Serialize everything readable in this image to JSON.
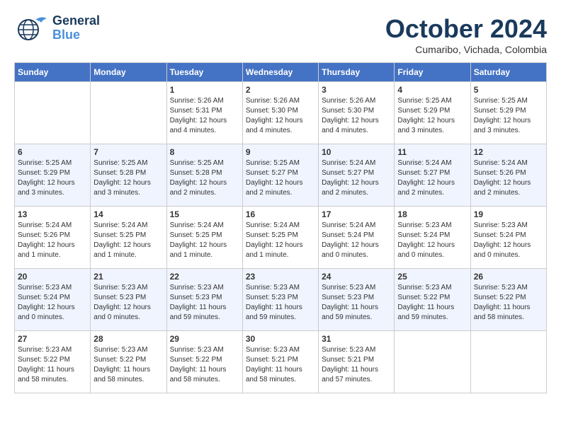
{
  "header": {
    "logo_line1": "General",
    "logo_line2": "Blue",
    "month_title": "October 2024",
    "location": "Cumaribo, Vichada, Colombia"
  },
  "days_of_week": [
    "Sunday",
    "Monday",
    "Tuesday",
    "Wednesday",
    "Thursday",
    "Friday",
    "Saturday"
  ],
  "weeks": [
    [
      {
        "day": "",
        "info": ""
      },
      {
        "day": "",
        "info": ""
      },
      {
        "day": "1",
        "info": "Sunrise: 5:26 AM\nSunset: 5:31 PM\nDaylight: 12 hours\nand 4 minutes."
      },
      {
        "day": "2",
        "info": "Sunrise: 5:26 AM\nSunset: 5:30 PM\nDaylight: 12 hours\nand 4 minutes."
      },
      {
        "day": "3",
        "info": "Sunrise: 5:26 AM\nSunset: 5:30 PM\nDaylight: 12 hours\nand 4 minutes."
      },
      {
        "day": "4",
        "info": "Sunrise: 5:25 AM\nSunset: 5:29 PM\nDaylight: 12 hours\nand 3 minutes."
      },
      {
        "day": "5",
        "info": "Sunrise: 5:25 AM\nSunset: 5:29 PM\nDaylight: 12 hours\nand 3 minutes."
      }
    ],
    [
      {
        "day": "6",
        "info": "Sunrise: 5:25 AM\nSunset: 5:29 PM\nDaylight: 12 hours\nand 3 minutes."
      },
      {
        "day": "7",
        "info": "Sunrise: 5:25 AM\nSunset: 5:28 PM\nDaylight: 12 hours\nand 3 minutes."
      },
      {
        "day": "8",
        "info": "Sunrise: 5:25 AM\nSunset: 5:28 PM\nDaylight: 12 hours\nand 2 minutes."
      },
      {
        "day": "9",
        "info": "Sunrise: 5:25 AM\nSunset: 5:27 PM\nDaylight: 12 hours\nand 2 minutes."
      },
      {
        "day": "10",
        "info": "Sunrise: 5:24 AM\nSunset: 5:27 PM\nDaylight: 12 hours\nand 2 minutes."
      },
      {
        "day": "11",
        "info": "Sunrise: 5:24 AM\nSunset: 5:27 PM\nDaylight: 12 hours\nand 2 minutes."
      },
      {
        "day": "12",
        "info": "Sunrise: 5:24 AM\nSunset: 5:26 PM\nDaylight: 12 hours\nand 2 minutes."
      }
    ],
    [
      {
        "day": "13",
        "info": "Sunrise: 5:24 AM\nSunset: 5:26 PM\nDaylight: 12 hours\nand 1 minute."
      },
      {
        "day": "14",
        "info": "Sunrise: 5:24 AM\nSunset: 5:25 PM\nDaylight: 12 hours\nand 1 minute."
      },
      {
        "day": "15",
        "info": "Sunrise: 5:24 AM\nSunset: 5:25 PM\nDaylight: 12 hours\nand 1 minute."
      },
      {
        "day": "16",
        "info": "Sunrise: 5:24 AM\nSunset: 5:25 PM\nDaylight: 12 hours\nand 1 minute."
      },
      {
        "day": "17",
        "info": "Sunrise: 5:24 AM\nSunset: 5:24 PM\nDaylight: 12 hours\nand 0 minutes."
      },
      {
        "day": "18",
        "info": "Sunrise: 5:23 AM\nSunset: 5:24 PM\nDaylight: 12 hours\nand 0 minutes."
      },
      {
        "day": "19",
        "info": "Sunrise: 5:23 AM\nSunset: 5:24 PM\nDaylight: 12 hours\nand 0 minutes."
      }
    ],
    [
      {
        "day": "20",
        "info": "Sunrise: 5:23 AM\nSunset: 5:24 PM\nDaylight: 12 hours\nand 0 minutes."
      },
      {
        "day": "21",
        "info": "Sunrise: 5:23 AM\nSunset: 5:23 PM\nDaylight: 12 hours\nand 0 minutes."
      },
      {
        "day": "22",
        "info": "Sunrise: 5:23 AM\nSunset: 5:23 PM\nDaylight: 11 hours\nand 59 minutes."
      },
      {
        "day": "23",
        "info": "Sunrise: 5:23 AM\nSunset: 5:23 PM\nDaylight: 11 hours\nand 59 minutes."
      },
      {
        "day": "24",
        "info": "Sunrise: 5:23 AM\nSunset: 5:23 PM\nDaylight: 11 hours\nand 59 minutes."
      },
      {
        "day": "25",
        "info": "Sunrise: 5:23 AM\nSunset: 5:22 PM\nDaylight: 11 hours\nand 59 minutes."
      },
      {
        "day": "26",
        "info": "Sunrise: 5:23 AM\nSunset: 5:22 PM\nDaylight: 11 hours\nand 58 minutes."
      }
    ],
    [
      {
        "day": "27",
        "info": "Sunrise: 5:23 AM\nSunset: 5:22 PM\nDaylight: 11 hours\nand 58 minutes."
      },
      {
        "day": "28",
        "info": "Sunrise: 5:23 AM\nSunset: 5:22 PM\nDaylight: 11 hours\nand 58 minutes."
      },
      {
        "day": "29",
        "info": "Sunrise: 5:23 AM\nSunset: 5:22 PM\nDaylight: 11 hours\nand 58 minutes."
      },
      {
        "day": "30",
        "info": "Sunrise: 5:23 AM\nSunset: 5:21 PM\nDaylight: 11 hours\nand 58 minutes."
      },
      {
        "day": "31",
        "info": "Sunrise: 5:23 AM\nSunset: 5:21 PM\nDaylight: 11 hours\nand 57 minutes."
      },
      {
        "day": "",
        "info": ""
      },
      {
        "day": "",
        "info": ""
      }
    ]
  ]
}
